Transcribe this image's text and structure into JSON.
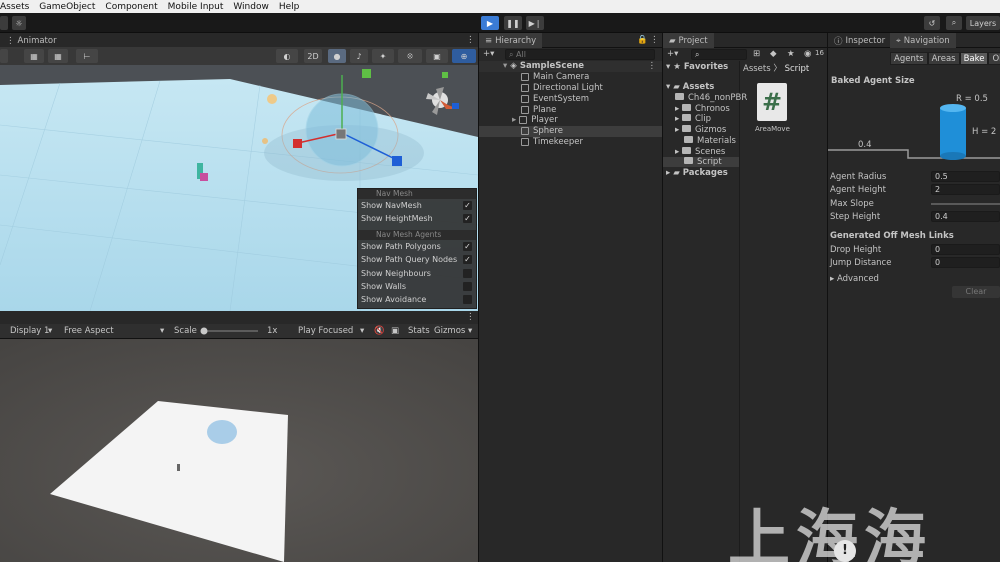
{
  "menu": [
    "Assets",
    "GameObject",
    "Component",
    "Mobile Input",
    "Window",
    "Help"
  ],
  "toolbar": {
    "layers_label": "Layers"
  },
  "scene_view": {
    "tab_label": "Animator",
    "mode_2d": "2D",
    "navmesh_overlay": {
      "nav_mesh_header": "Nav Mesh",
      "nav_mesh_items": [
        {
          "label": "Show NavMesh",
          "checked": true
        },
        {
          "label": "Show HeightMesh",
          "checked": true
        }
      ],
      "agents_header": "Nav Mesh Agents",
      "agent_items": [
        {
          "label": "Show Path Polygons",
          "checked": true
        },
        {
          "label": "Show Path Query Nodes",
          "checked": true
        },
        {
          "label": "Show Neighbours",
          "checked": false
        },
        {
          "label": "Show Walls",
          "checked": false
        },
        {
          "label": "Show Avoidance",
          "checked": false
        }
      ]
    }
  },
  "game_view": {
    "display": "Display 1",
    "aspect": "Free Aspect",
    "scale_label": "Scale",
    "scale_value": "1x",
    "play_mode": "Play Focused",
    "stats": "Stats",
    "gizmos": "Gizmos"
  },
  "hierarchy": {
    "tab_label": "Hierarchy",
    "search_placeholder": "All",
    "scene": "SampleScene",
    "items": [
      "Main Camera",
      "Directional Light",
      "EventSystem",
      "Plane",
      "Player",
      "Sphere",
      "Timekeeper"
    ],
    "selected": "Sphere"
  },
  "project": {
    "tab_label": "Project",
    "favorites": "Favorites",
    "assets": "Assets",
    "folders": [
      "Ch46_nonPBR",
      "Chronos",
      "Clip",
      "Gizmos",
      "Materials",
      "Scenes",
      "Script"
    ],
    "packages": "Packages",
    "breadcrumb": [
      "Assets",
      "Script"
    ],
    "file_name": "AreaMove",
    "count_badge": "16"
  },
  "inspector": {
    "tab_inspector": "Inspector",
    "tab_navigation": "Navigation",
    "subtabs": [
      "Agents",
      "Areas",
      "Bake",
      "Obj"
    ],
    "active_subtab": "Bake",
    "baked_agent_size": "Baked Agent Size",
    "diagram_r": "R = 0.5",
    "diagram_h": "H = 2",
    "diagram_step": "0.4",
    "fields": [
      {
        "label": "Agent Radius",
        "value": "0.5"
      },
      {
        "label": "Agent Height",
        "value": "2"
      },
      {
        "label": "Max Slope",
        "value": ""
      },
      {
        "label": "Step Height",
        "value": "0.4"
      }
    ],
    "offmesh_header": "Generated Off Mesh Links",
    "offmesh_fields": [
      {
        "label": "Drop Height",
        "value": "0"
      },
      {
        "label": "Jump Distance",
        "value": "0"
      }
    ],
    "advanced": "Advanced",
    "clear_button": "Clear"
  },
  "watermark": "上海海"
}
